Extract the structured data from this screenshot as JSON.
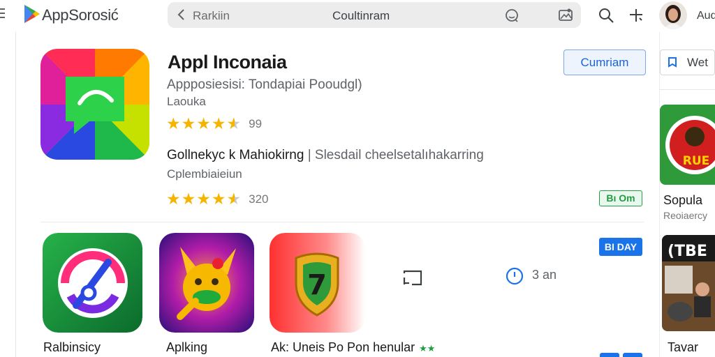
{
  "header": {
    "brand": "AppSorosić",
    "search_query": "Rarkiin",
    "search_center": "Coultinram",
    "account_name": "Aud"
  },
  "featured": {
    "title": "Appl Inconaia",
    "subtitle": "Appposiesisi: Tondapiai Pooudgl)",
    "category": "Laouka",
    "rating_count": "99",
    "button_label": "Cumriam",
    "line2_main": "Gollnekyc k Mahiokirng",
    "line2_muted": " | Slesdail cheelsetalıhakarring",
    "line2_sub": "Cplembiaieiun",
    "rating2_count": "320",
    "green_badge": "Bı Om"
  },
  "apps": [
    {
      "label": "Ralbinsicy"
    },
    {
      "label": "Aplking"
    },
    {
      "label": "Ak: Uneis Po Pon henular",
      "tag": "★★"
    }
  ],
  "row_tools": {
    "clock_text": "3 an",
    "blue_badge": "BI DAY"
  },
  "right_panel": {
    "button_label": "Wet",
    "card1_title": "Sopula",
    "card1_sub": "Reoiaercy",
    "card1_art_text": "RUE",
    "card2_title": "Tavar Be",
    "card2_art_text": "(TBE"
  },
  "colors": {
    "accent_blue": "#1a73e8",
    "star": "#f6b400",
    "green": "#1f9d3f"
  },
  "icons": [
    "menu-icon",
    "play-logo-icon",
    "back-arrow-icon",
    "emoji-icon",
    "image-icon",
    "search-icon",
    "add-icon",
    "cast-icon",
    "clock-icon",
    "pin-icon"
  ]
}
